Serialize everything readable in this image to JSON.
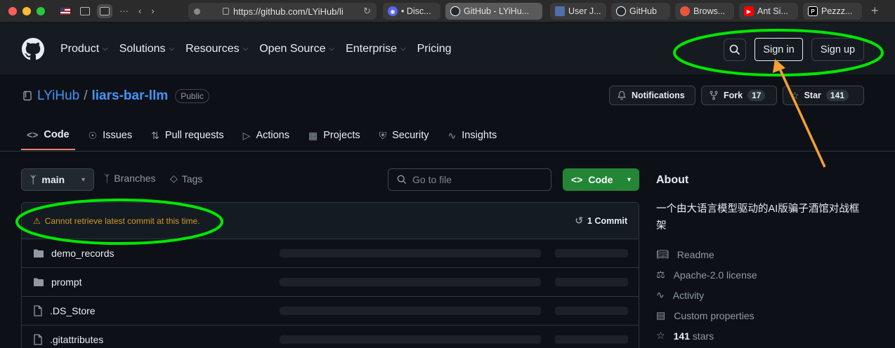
{
  "browser": {
    "url": "https://github.com/LYiHub/li",
    "tabs": [
      {
        "label": "• Disc...",
        "color": "#5865f2"
      },
      {
        "label": "GitHub - LYiHu...",
        "color": "#24292f"
      },
      {
        "label": "User J...",
        "color": "#4f6fa8"
      },
      {
        "label": "GitHub",
        "color": "#24292f"
      },
      {
        "label": "Brows...",
        "color": "#e8553a"
      },
      {
        "label": "Ant Si...",
        "color": "#ff0000"
      },
      {
        "label": "Pezzz...",
        "color": "#000000"
      }
    ]
  },
  "header": {
    "nav": [
      "Product",
      "Solutions",
      "Resources",
      "Open Source",
      "Enterprise",
      "Pricing"
    ],
    "sign_in": "Sign in",
    "sign_up": "Sign up"
  },
  "repo": {
    "owner": "LYiHub",
    "slash": "/",
    "name": "liars-bar-llm",
    "visibility": "Public",
    "notifications": "Notifications",
    "fork_label": "Fork",
    "fork_count": "17",
    "star_label": "Star",
    "star_count": "141",
    "tabs": [
      "Code",
      "Issues",
      "Pull requests",
      "Actions",
      "Projects",
      "Security",
      "Insights"
    ]
  },
  "toolbar": {
    "branch": "main",
    "branches": "Branches",
    "tags": "Tags",
    "go_to_file": "Go to file",
    "code": "Code"
  },
  "files": {
    "warning": "Cannot retrieve latest commit at this time.",
    "commits": "1 Commit",
    "rows": [
      {
        "name": "demo_records",
        "type": "folder"
      },
      {
        "name": "prompt",
        "type": "folder"
      },
      {
        "name": ".DS_Store",
        "type": "file"
      },
      {
        "name": ".gitattributes",
        "type": "file"
      }
    ]
  },
  "about": {
    "title": "About",
    "description": "一个由大语言模型驱动的AI版骗子酒馆对战框架",
    "items": [
      "Readme",
      "Apache-2.0 license",
      "Activity",
      "Custom properties"
    ],
    "stars": "141",
    "stars_suffix": " stars"
  },
  "colors": {
    "annotation_green": "#00e600",
    "annotation_orange": "#f5a033",
    "accent_blue": "#4493f8",
    "code_button_green": "#238636"
  }
}
